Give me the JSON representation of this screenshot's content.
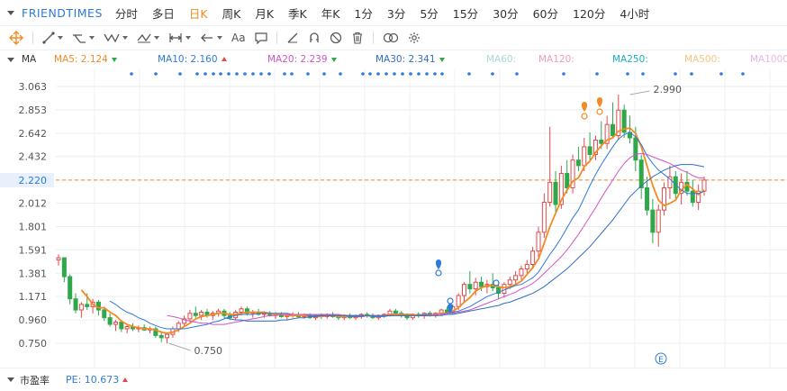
{
  "symbol": {
    "name": "FRIENDTIMES"
  },
  "periods": [
    "分时",
    "多日",
    "日K",
    "周K",
    "月K",
    "季K",
    "年K",
    "1分",
    "3分",
    "5分",
    "15分",
    "30分",
    "60分",
    "120分",
    "4小时"
  ],
  "active_period": "日K",
  "toolbar": {
    "text_tool": "Aa"
  },
  "ma_bar": {
    "label": "MA",
    "items": [
      {
        "text": "MA5: 2.124",
        "color": "#f38a22",
        "trend": "down"
      },
      {
        "text": "MA10: 2.160",
        "color": "#2f7bd8",
        "trend": "up"
      },
      {
        "text": "MA20: 2.239",
        "color": "#d155c7",
        "trend": "down"
      },
      {
        "text": "MA30: 2.341",
        "color": "#2f6fc2",
        "trend": "down"
      },
      {
        "text": "MA60:",
        "color": "#a8d8d6",
        "trend": ""
      },
      {
        "text": "MA120:",
        "color": "#ee9fb3",
        "trend": ""
      },
      {
        "text": "MA250:",
        "color": "#17b0c8",
        "trend": ""
      },
      {
        "text": "MA500:",
        "color": "#f4c77d",
        "trend": ""
      },
      {
        "text": "MA1000",
        "color": "#e5b8e6",
        "trend": ""
      }
    ]
  },
  "footer": {
    "label": "市盈率",
    "pe": "PE: 10.673"
  },
  "chart_data": {
    "type": "candlestick",
    "y_ticks": [
      3.063,
      2.853,
      2.642,
      2.432,
      2.22,
      2.012,
      1.801,
      1.591,
      1.381,
      1.171,
      0.96,
      0.75
    ],
    "ylim": [
      0.62,
      3.2
    ],
    "current_price": 2.22,
    "annotations": {
      "high": 2.99,
      "low": 0.75
    },
    "high_label": "2.990",
    "low_label": "0.750",
    "grid": true,
    "candles": [
      [
        1.5,
        1.55,
        1.45,
        1.52
      ],
      [
        1.52,
        1.52,
        1.3,
        1.35
      ],
      [
        1.35,
        1.37,
        1.1,
        1.15
      ],
      [
        1.15,
        1.2,
        1.02,
        1.05
      ],
      [
        1.05,
        1.12,
        0.98,
        1.1
      ],
      [
        1.1,
        1.2,
        1.05,
        1.08
      ],
      [
        1.08,
        1.15,
        1.02,
        1.12
      ],
      [
        1.12,
        1.14,
        1.0,
        1.05
      ],
      [
        1.05,
        1.08,
        0.95,
        0.98
      ],
      [
        0.98,
        1.02,
        0.9,
        0.92
      ],
      [
        0.92,
        0.96,
        0.86,
        0.94
      ],
      [
        0.94,
        0.96,
        0.85,
        0.88
      ],
      [
        0.88,
        0.92,
        0.84,
        0.9
      ],
      [
        0.9,
        0.93,
        0.86,
        0.88
      ],
      [
        0.88,
        0.91,
        0.85,
        0.89
      ],
      [
        0.89,
        0.92,
        0.86,
        0.87
      ],
      [
        0.87,
        0.9,
        0.84,
        0.88
      ],
      [
        0.88,
        0.9,
        0.8,
        0.82
      ],
      [
        0.82,
        0.86,
        0.76,
        0.8
      ],
      [
        0.8,
        0.84,
        0.75,
        0.83
      ],
      [
        0.83,
        0.9,
        0.8,
        0.88
      ],
      [
        0.88,
        0.95,
        0.85,
        0.93
      ],
      [
        0.93,
        1.0,
        0.9,
        0.97
      ],
      [
        0.97,
        1.05,
        0.94,
        1.02
      ],
      [
        1.02,
        1.08,
        0.98,
        1.0
      ],
      [
        1.0,
        1.05,
        0.96,
        1.03
      ],
      [
        1.03,
        1.06,
        0.98,
        1.0
      ],
      [
        1.0,
        1.04,
        0.96,
        1.02
      ],
      [
        1.02,
        1.06,
        0.99,
        1.04
      ],
      [
        1.04,
        1.06,
        0.98,
        1.0
      ],
      [
        1.0,
        1.03,
        0.96,
        0.98
      ],
      [
        0.98,
        1.05,
        0.96,
        1.03
      ],
      [
        1.03,
        1.08,
        1.0,
        1.06
      ],
      [
        1.06,
        1.08,
        1.0,
        1.02
      ],
      [
        1.02,
        1.05,
        0.98,
        1.03
      ],
      [
        1.03,
        1.06,
        1.0,
        1.01
      ],
      [
        1.01,
        1.04,
        0.98,
        1.02
      ],
      [
        1.02,
        1.04,
        0.99,
        1.0
      ],
      [
        1.0,
        1.03,
        0.97,
        1.01
      ],
      [
        1.01,
        1.03,
        0.98,
        0.99
      ],
      [
        0.99,
        1.02,
        0.96,
        1.0
      ],
      [
        1.0,
        1.03,
        0.98,
        1.01
      ],
      [
        1.01,
        1.03,
        0.98,
        0.99
      ],
      [
        0.99,
        1.02,
        0.97,
        1.0
      ],
      [
        1.0,
        1.02,
        0.97,
        0.98
      ],
      [
        0.98,
        1.01,
        0.96,
        1.0
      ],
      [
        1.0,
        1.02,
        0.97,
        0.99
      ],
      [
        0.99,
        1.02,
        0.97,
        1.01
      ],
      [
        1.01,
        1.03,
        0.98,
        0.99
      ],
      [
        0.99,
        1.01,
        0.96,
        0.98
      ],
      [
        0.98,
        1.01,
        0.96,
        1.0
      ],
      [
        1.0,
        1.02,
        0.97,
        0.98
      ],
      [
        0.98,
        1.01,
        0.96,
        0.99
      ],
      [
        0.99,
        1.02,
        0.97,
        1.01
      ],
      [
        1.01,
        1.03,
        0.98,
        1.0
      ],
      [
        1.0,
        1.02,
        0.97,
        0.98
      ],
      [
        0.98,
        1.01,
        0.96,
        1.0
      ],
      [
        1.0,
        1.02,
        0.98,
        1.01
      ],
      [
        1.01,
        1.06,
        0.99,
        1.04
      ],
      [
        1.04,
        1.06,
        1.0,
        1.02
      ],
      [
        1.02,
        1.04,
        0.98,
        1.0
      ],
      [
        1.0,
        1.02,
        0.96,
        0.98
      ],
      [
        0.98,
        1.02,
        0.96,
        1.01
      ],
      [
        1.01,
        1.03,
        0.98,
        1.0
      ],
      [
        1.0,
        1.03,
        0.97,
        1.02
      ],
      [
        1.02,
        1.04,
        0.99,
        1.0
      ],
      [
        1.0,
        1.03,
        0.98,
        1.02
      ],
      [
        1.02,
        1.06,
        1.0,
        1.05
      ],
      [
        1.05,
        1.08,
        1.02,
        1.03
      ],
      [
        1.03,
        1.1,
        1.01,
        1.08
      ],
      [
        1.08,
        1.2,
        1.05,
        1.18
      ],
      [
        1.18,
        1.3,
        1.12,
        1.28
      ],
      [
        1.28,
        1.4,
        1.2,
        1.24
      ],
      [
        1.24,
        1.34,
        1.18,
        1.3
      ],
      [
        1.3,
        1.35,
        1.22,
        1.26
      ],
      [
        1.26,
        1.32,
        1.2,
        1.28
      ],
      [
        1.28,
        1.38,
        1.22,
        1.25
      ],
      [
        1.25,
        1.3,
        1.15,
        1.2
      ],
      [
        1.2,
        1.3,
        1.16,
        1.28
      ],
      [
        1.28,
        1.35,
        1.24,
        1.32
      ],
      [
        1.32,
        1.4,
        1.28,
        1.36
      ],
      [
        1.36,
        1.45,
        1.32,
        1.42
      ],
      [
        1.42,
        1.5,
        1.38,
        1.46
      ],
      [
        1.46,
        1.62,
        1.42,
        1.58
      ],
      [
        1.58,
        1.8,
        1.52,
        1.75
      ],
      [
        1.75,
        2.1,
        1.7,
        2.02
      ],
      [
        2.02,
        2.7,
        1.98,
        2.2
      ],
      [
        2.2,
        2.3,
        1.92,
        2.0
      ],
      [
        2.0,
        2.35,
        1.96,
        2.28
      ],
      [
        2.28,
        2.4,
        2.1,
        2.15
      ],
      [
        2.15,
        2.45,
        2.1,
        2.4
      ],
      [
        2.4,
        2.52,
        2.3,
        2.35
      ],
      [
        2.35,
        2.6,
        2.3,
        2.52
      ],
      [
        2.52,
        2.65,
        2.4,
        2.45
      ],
      [
        2.45,
        2.62,
        2.4,
        2.58
      ],
      [
        2.58,
        2.75,
        2.5,
        2.55
      ],
      [
        2.55,
        2.8,
        2.5,
        2.72
      ],
      [
        2.72,
        2.92,
        2.6,
        2.62
      ],
      [
        2.62,
        2.99,
        2.58,
        2.85
      ],
      [
        2.85,
        2.9,
        2.6,
        2.65
      ],
      [
        2.65,
        2.8,
        2.55,
        2.6
      ],
      [
        2.6,
        2.7,
        2.3,
        2.4
      ],
      [
        2.4,
        2.45,
        2.05,
        2.15
      ],
      [
        2.15,
        2.25,
        1.9,
        1.95
      ],
      [
        1.95,
        2.05,
        1.65,
        1.75
      ],
      [
        1.75,
        2.0,
        1.62,
        1.95
      ],
      [
        1.95,
        2.2,
        1.9,
        2.15
      ],
      [
        2.15,
        2.35,
        2.05,
        2.25
      ],
      [
        2.25,
        2.3,
        2.05,
        2.1
      ],
      [
        2.1,
        2.28,
        2.0,
        2.2
      ],
      [
        2.2,
        2.3,
        2.08,
        2.12
      ],
      [
        2.12,
        2.22,
        1.98,
        2.02
      ],
      [
        2.02,
        2.18,
        1.95,
        2.12
      ],
      [
        2.12,
        2.25,
        2.08,
        2.22
      ]
    ],
    "ma": [
      {
        "name": "MA5",
        "color": "#f38a22",
        "values": [
          null,
          null,
          null,
          null,
          1.23,
          1.17,
          1.1,
          1.07,
          1.07,
          1.03,
          1.0,
          0.95,
          0.92,
          0.9,
          0.89,
          0.88,
          0.88,
          0.87,
          0.85,
          0.84,
          0.85,
          0.87,
          0.9,
          0.93,
          0.97,
          0.99,
          1.0,
          1.01,
          1.02,
          1.02,
          1.01,
          1.01,
          1.02,
          1.03,
          1.03,
          1.03,
          1.03,
          1.02,
          1.01,
          1.01,
          1.0,
          1.0,
          1.0,
          1.0,
          1.0,
          0.99,
          0.99,
          1.0,
          1.0,
          0.99,
          0.99,
          0.99,
          0.99,
          0.99,
          1.0,
          0.99,
          0.99,
          1.0,
          1.01,
          1.01,
          1.01,
          1.01,
          1.01,
          1.0,
          1.0,
          1.0,
          1.01,
          1.02,
          1.02,
          1.04,
          1.07,
          1.12,
          1.16,
          1.22,
          1.25,
          1.27,
          1.27,
          1.26,
          1.25,
          1.26,
          1.28,
          1.31,
          1.37,
          1.43,
          1.51,
          1.65,
          1.8,
          1.92,
          2.04,
          2.13,
          2.21,
          2.24,
          2.34,
          2.39,
          2.47,
          2.53,
          2.58,
          2.6,
          2.66,
          2.68,
          2.69,
          2.64,
          2.52,
          2.35,
          2.17,
          2.04,
          1.99,
          2.01,
          2.04,
          2.13,
          2.18,
          2.14,
          2.09,
          2.13
        ]
      },
      {
        "name": "MA10",
        "color": "#2f7bd8",
        "values": [
          null,
          null,
          null,
          null,
          null,
          null,
          null,
          null,
          null,
          1.13,
          1.1,
          1.06,
          1.03,
          1.01,
          0.98,
          0.96,
          0.93,
          0.91,
          0.89,
          0.88,
          0.88,
          0.88,
          0.88,
          0.89,
          0.9,
          0.91,
          0.92,
          0.94,
          0.95,
          0.97,
          0.99,
          1.0,
          1.01,
          1.01,
          1.01,
          1.02,
          1.02,
          1.02,
          1.02,
          1.02,
          1.02,
          1.01,
          1.01,
          1.01,
          1.0,
          1.0,
          1.0,
          1.0,
          1.0,
          1.0,
          1.0,
          0.99,
          0.99,
          0.99,
          1.0,
          0.99,
          0.99,
          0.99,
          1.0,
          1.0,
          1.0,
          1.0,
          1.0,
          1.0,
          1.01,
          1.01,
          1.01,
          1.01,
          1.02,
          1.03,
          1.04,
          1.06,
          1.08,
          1.11,
          1.14,
          1.17,
          1.19,
          1.21,
          1.23,
          1.25,
          1.27,
          1.28,
          1.31,
          1.34,
          1.39,
          1.47,
          1.55,
          1.62,
          1.7,
          1.79,
          1.88,
          1.95,
          2.06,
          2.17,
          2.27,
          2.36,
          2.44,
          2.52,
          2.59,
          2.63,
          2.65,
          2.61,
          2.54,
          2.44,
          2.37,
          2.31,
          2.27,
          2.23,
          2.18,
          2.13,
          2.1,
          2.1,
          2.1,
          2.12
        ]
      },
      {
        "name": "MA20",
        "color": "#d155c7",
        "values": [
          null,
          null,
          null,
          null,
          null,
          null,
          null,
          null,
          null,
          null,
          null,
          null,
          null,
          null,
          null,
          null,
          null,
          null,
          null,
          1.0,
          0.99,
          0.98,
          0.96,
          0.95,
          0.94,
          0.93,
          0.93,
          0.92,
          0.92,
          0.92,
          0.93,
          0.94,
          0.95,
          0.96,
          0.97,
          0.98,
          0.99,
          1.0,
          1.0,
          1.01,
          1.01,
          1.01,
          1.01,
          1.01,
          1.01,
          1.01,
          1.01,
          1.01,
          1.01,
          1.01,
          1.0,
          1.0,
          1.0,
          1.0,
          1.0,
          1.0,
          1.0,
          1.0,
          1.0,
          1.0,
          1.0,
          1.0,
          1.0,
          1.0,
          1.0,
          1.01,
          1.01,
          1.01,
          1.02,
          1.02,
          1.03,
          1.04,
          1.05,
          1.07,
          1.09,
          1.11,
          1.13,
          1.15,
          1.17,
          1.19,
          1.21,
          1.24,
          1.26,
          1.29,
          1.33,
          1.38,
          1.43,
          1.48,
          1.53,
          1.59,
          1.66,
          1.73,
          1.81,
          1.89,
          1.97,
          2.06,
          2.14,
          2.22,
          2.3,
          2.37,
          2.42,
          2.45,
          2.46,
          2.45,
          2.43,
          2.41,
          2.39,
          2.37,
          2.34,
          2.31,
          2.29,
          2.26,
          2.24,
          2.24
        ]
      },
      {
        "name": "MA30",
        "color": "#2f6fc2",
        "values": [
          null,
          null,
          null,
          null,
          null,
          null,
          null,
          null,
          null,
          null,
          null,
          null,
          null,
          null,
          null,
          null,
          null,
          null,
          null,
          null,
          null,
          null,
          null,
          null,
          null,
          null,
          null,
          null,
          null,
          0.98,
          0.97,
          0.96,
          0.96,
          0.95,
          0.95,
          0.95,
          0.95,
          0.95,
          0.95,
          0.96,
          0.96,
          0.97,
          0.98,
          0.98,
          0.99,
          0.99,
          1.0,
          1.0,
          1.0,
          1.0,
          1.0,
          1.0,
          1.0,
          1.0,
          1.0,
          1.0,
          1.0,
          1.0,
          1.0,
          1.0,
          1.0,
          1.0,
          1.0,
          1.0,
          1.0,
          1.0,
          1.0,
          1.0,
          1.01,
          1.01,
          1.02,
          1.03,
          1.04,
          1.05,
          1.06,
          1.07,
          1.08,
          1.09,
          1.11,
          1.12,
          1.14,
          1.16,
          1.18,
          1.2,
          1.23,
          1.26,
          1.3,
          1.34,
          1.38,
          1.42,
          1.47,
          1.52,
          1.57,
          1.62,
          1.68,
          1.74,
          1.8,
          1.86,
          1.93,
          2.0,
          2.07,
          2.12,
          2.17,
          2.21,
          2.25,
          2.28,
          2.31,
          2.33,
          2.35,
          2.36,
          2.36,
          2.36,
          2.35,
          2.34
        ]
      }
    ]
  }
}
